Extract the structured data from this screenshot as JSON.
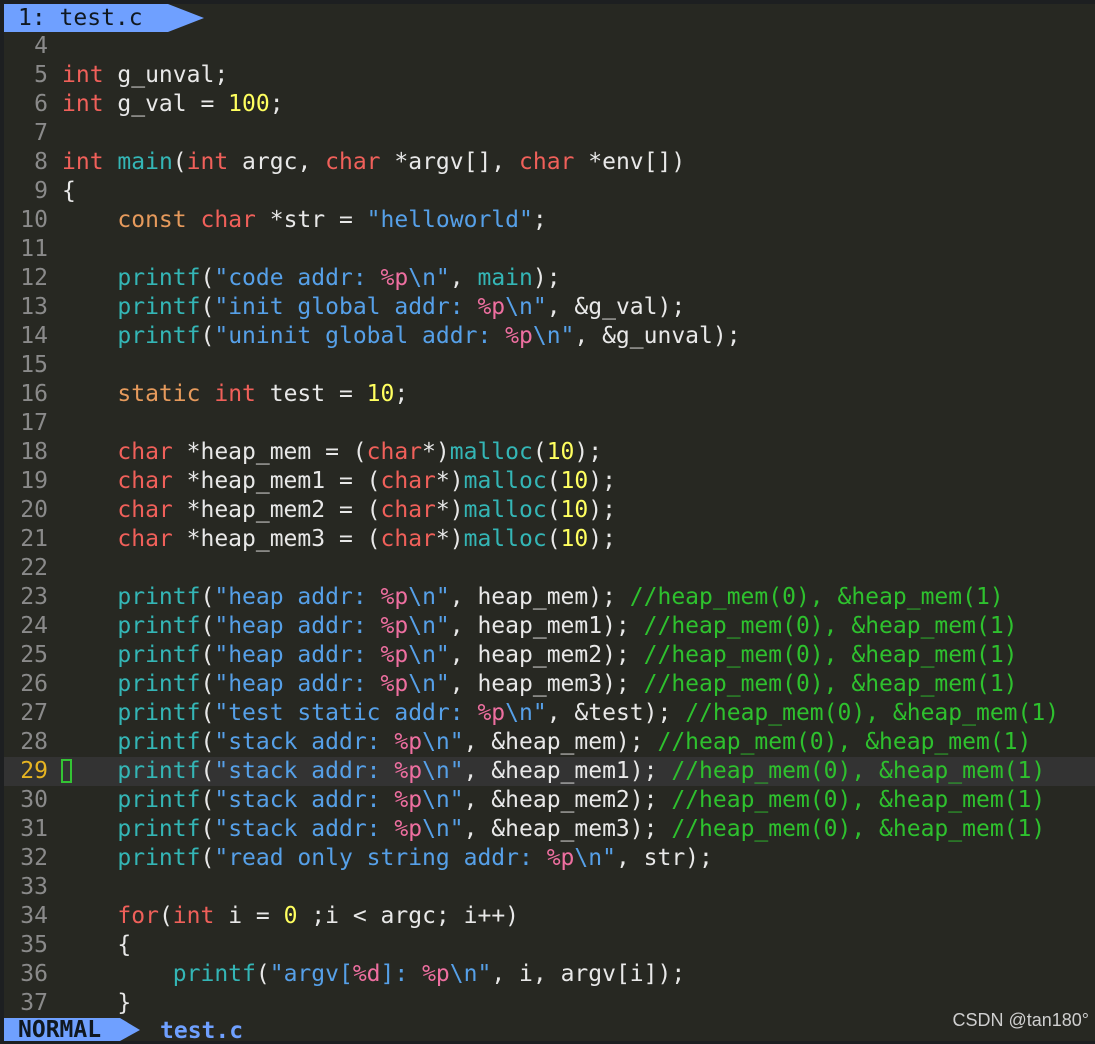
{
  "tabline": {
    "tab_label": "1: test.c"
  },
  "editor": {
    "current_line": 29,
    "lines": [
      {
        "n": "4",
        "seg": []
      },
      {
        "n": "5",
        "seg": [
          [
            "ty",
            "int"
          ],
          [
            "pl",
            " g_unval;"
          ]
        ]
      },
      {
        "n": "6",
        "seg": [
          [
            "ty",
            "int"
          ],
          [
            "pl",
            " g_val = "
          ],
          [
            "nm",
            "100"
          ],
          [
            "pl",
            ";"
          ]
        ]
      },
      {
        "n": "7",
        "seg": []
      },
      {
        "n": "8",
        "seg": [
          [
            "ty",
            "int"
          ],
          [
            "pl",
            " "
          ],
          [
            "fn",
            "main"
          ],
          [
            "pl",
            "("
          ],
          [
            "ty",
            "int"
          ],
          [
            "pl",
            " argc, "
          ],
          [
            "ty",
            "char"
          ],
          [
            "pl",
            " *argv[], "
          ],
          [
            "ty",
            "char"
          ],
          [
            "pl",
            " *env[])"
          ]
        ]
      },
      {
        "n": "9",
        "seg": [
          [
            "pl",
            "{"
          ]
        ]
      },
      {
        "n": "10",
        "seg": [
          [
            "pl",
            "    "
          ],
          [
            "cq",
            "const"
          ],
          [
            "pl",
            " "
          ],
          [
            "ty",
            "char"
          ],
          [
            "pl",
            " *str = "
          ],
          [
            "st",
            "\"helloworld\""
          ],
          [
            "pl",
            ";"
          ]
        ]
      },
      {
        "n": "11",
        "seg": []
      },
      {
        "n": "12",
        "seg": [
          [
            "pl",
            "    "
          ],
          [
            "fn",
            "printf"
          ],
          [
            "pl",
            "("
          ],
          [
            "st",
            "\"code addr: "
          ],
          [
            "fm",
            "%p"
          ],
          [
            "st",
            "\\n\""
          ],
          [
            "pl",
            ", "
          ],
          [
            "fn",
            "main"
          ],
          [
            "pl",
            ");"
          ]
        ]
      },
      {
        "n": "13",
        "seg": [
          [
            "pl",
            "    "
          ],
          [
            "fn",
            "printf"
          ],
          [
            "pl",
            "("
          ],
          [
            "st",
            "\"init global addr: "
          ],
          [
            "fm",
            "%p"
          ],
          [
            "st",
            "\\n\""
          ],
          [
            "pl",
            ", &g_val);"
          ]
        ]
      },
      {
        "n": "14",
        "seg": [
          [
            "pl",
            "    "
          ],
          [
            "fn",
            "printf"
          ],
          [
            "pl",
            "("
          ],
          [
            "st",
            "\"uninit global addr: "
          ],
          [
            "fm",
            "%p"
          ],
          [
            "st",
            "\\n\""
          ],
          [
            "pl",
            ", &g_unval);"
          ]
        ]
      },
      {
        "n": "15",
        "seg": []
      },
      {
        "n": "16",
        "seg": [
          [
            "pl",
            "    "
          ],
          [
            "cq",
            "static"
          ],
          [
            "pl",
            " "
          ],
          [
            "ty",
            "int"
          ],
          [
            "pl",
            " test = "
          ],
          [
            "nm",
            "10"
          ],
          [
            "pl",
            ";"
          ]
        ]
      },
      {
        "n": "17",
        "seg": []
      },
      {
        "n": "18",
        "seg": [
          [
            "pl",
            "    "
          ],
          [
            "ty",
            "char"
          ],
          [
            "pl",
            " *heap_mem = ("
          ],
          [
            "ty",
            "char"
          ],
          [
            "pl",
            "*)"
          ],
          [
            "fn",
            "malloc"
          ],
          [
            "pl",
            "("
          ],
          [
            "nm",
            "10"
          ],
          [
            "pl",
            ");"
          ]
        ]
      },
      {
        "n": "19",
        "seg": [
          [
            "pl",
            "    "
          ],
          [
            "ty",
            "char"
          ],
          [
            "pl",
            " *heap_mem1 = ("
          ],
          [
            "ty",
            "char"
          ],
          [
            "pl",
            "*)"
          ],
          [
            "fn",
            "malloc"
          ],
          [
            "pl",
            "("
          ],
          [
            "nm",
            "10"
          ],
          [
            "pl",
            ");"
          ]
        ]
      },
      {
        "n": "20",
        "seg": [
          [
            "pl",
            "    "
          ],
          [
            "ty",
            "char"
          ],
          [
            "pl",
            " *heap_mem2 = ("
          ],
          [
            "ty",
            "char"
          ],
          [
            "pl",
            "*)"
          ],
          [
            "fn",
            "malloc"
          ],
          [
            "pl",
            "("
          ],
          [
            "nm",
            "10"
          ],
          [
            "pl",
            ");"
          ]
        ]
      },
      {
        "n": "21",
        "seg": [
          [
            "pl",
            "    "
          ],
          [
            "ty",
            "char"
          ],
          [
            "pl",
            " *heap_mem3 = ("
          ],
          [
            "ty",
            "char"
          ],
          [
            "pl",
            "*)"
          ],
          [
            "fn",
            "malloc"
          ],
          [
            "pl",
            "("
          ],
          [
            "nm",
            "10"
          ],
          [
            "pl",
            ");"
          ]
        ]
      },
      {
        "n": "22",
        "seg": []
      },
      {
        "n": "23",
        "seg": [
          [
            "pl",
            "    "
          ],
          [
            "fn",
            "printf"
          ],
          [
            "pl",
            "("
          ],
          [
            "st",
            "\"heap addr: "
          ],
          [
            "fm",
            "%p"
          ],
          [
            "st",
            "\\n\""
          ],
          [
            "pl",
            ", heap_mem); "
          ],
          [
            "cm",
            "//heap_mem(0), &heap_mem(1)"
          ]
        ]
      },
      {
        "n": "24",
        "seg": [
          [
            "pl",
            "    "
          ],
          [
            "fn",
            "printf"
          ],
          [
            "pl",
            "("
          ],
          [
            "st",
            "\"heap addr: "
          ],
          [
            "fm",
            "%p"
          ],
          [
            "st",
            "\\n\""
          ],
          [
            "pl",
            ", heap_mem1); "
          ],
          [
            "cm",
            "//heap_mem(0), &heap_mem(1)"
          ]
        ]
      },
      {
        "n": "25",
        "seg": [
          [
            "pl",
            "    "
          ],
          [
            "fn",
            "printf"
          ],
          [
            "pl",
            "("
          ],
          [
            "st",
            "\"heap addr: "
          ],
          [
            "fm",
            "%p"
          ],
          [
            "st",
            "\\n\""
          ],
          [
            "pl",
            ", heap_mem2); "
          ],
          [
            "cm",
            "//heap_mem(0), &heap_mem(1)"
          ]
        ]
      },
      {
        "n": "26",
        "seg": [
          [
            "pl",
            "    "
          ],
          [
            "fn",
            "printf"
          ],
          [
            "pl",
            "("
          ],
          [
            "st",
            "\"heap addr: "
          ],
          [
            "fm",
            "%p"
          ],
          [
            "st",
            "\\n\""
          ],
          [
            "pl",
            ", heap_mem3); "
          ],
          [
            "cm",
            "//heap_mem(0), &heap_mem(1)"
          ]
        ]
      },
      {
        "n": "27",
        "seg": [
          [
            "pl",
            "    "
          ],
          [
            "fn",
            "printf"
          ],
          [
            "pl",
            "("
          ],
          [
            "st",
            "\"test static addr: "
          ],
          [
            "fm",
            "%p"
          ],
          [
            "st",
            "\\n\""
          ],
          [
            "pl",
            ", &test); "
          ],
          [
            "cm",
            "//heap_mem(0), &heap_mem(1)"
          ]
        ]
      },
      {
        "n": "28",
        "seg": [
          [
            "pl",
            "    "
          ],
          [
            "fn",
            "printf"
          ],
          [
            "pl",
            "("
          ],
          [
            "st",
            "\"stack addr: "
          ],
          [
            "fm",
            "%p"
          ],
          [
            "st",
            "\\n\""
          ],
          [
            "pl",
            ", &heap_mem); "
          ],
          [
            "cm",
            "//heap_mem(0), &heap_mem(1)"
          ]
        ]
      },
      {
        "n": "29",
        "seg": [
          [
            "pl",
            "    "
          ],
          [
            "fn",
            "printf"
          ],
          [
            "pl",
            "("
          ],
          [
            "st",
            "\"stack addr: "
          ],
          [
            "fm",
            "%p"
          ],
          [
            "st",
            "\\n\""
          ],
          [
            "pl",
            ", &heap_mem1); "
          ],
          [
            "cm",
            "//heap_mem(0), &heap_mem(1)"
          ]
        ]
      },
      {
        "n": "30",
        "seg": [
          [
            "pl",
            "    "
          ],
          [
            "fn",
            "printf"
          ],
          [
            "pl",
            "("
          ],
          [
            "st",
            "\"stack addr: "
          ],
          [
            "fm",
            "%p"
          ],
          [
            "st",
            "\\n\""
          ],
          [
            "pl",
            ", &heap_mem2); "
          ],
          [
            "cm",
            "//heap_mem(0), &heap_mem(1)"
          ]
        ]
      },
      {
        "n": "31",
        "seg": [
          [
            "pl",
            "    "
          ],
          [
            "fn",
            "printf"
          ],
          [
            "pl",
            "("
          ],
          [
            "st",
            "\"stack addr: "
          ],
          [
            "fm",
            "%p"
          ],
          [
            "st",
            "\\n\""
          ],
          [
            "pl",
            ", &heap_mem3); "
          ],
          [
            "cm",
            "//heap_mem(0), &heap_mem(1)"
          ]
        ]
      },
      {
        "n": "32",
        "seg": [
          [
            "pl",
            "    "
          ],
          [
            "fn",
            "printf"
          ],
          [
            "pl",
            "("
          ],
          [
            "st",
            "\"read only string addr: "
          ],
          [
            "fm",
            "%p"
          ],
          [
            "st",
            "\\n\""
          ],
          [
            "pl",
            ", str);"
          ]
        ]
      },
      {
        "n": "33",
        "seg": []
      },
      {
        "n": "34",
        "seg": [
          [
            "pl",
            "    "
          ],
          [
            "kw",
            "for"
          ],
          [
            "pl",
            "("
          ],
          [
            "ty",
            "int"
          ],
          [
            "pl",
            " i = "
          ],
          [
            "nm",
            "0"
          ],
          [
            "pl",
            " ;i < argc; i++)"
          ]
        ]
      },
      {
        "n": "35",
        "seg": [
          [
            "pl",
            "    {"
          ]
        ]
      },
      {
        "n": "36",
        "seg": [
          [
            "pl",
            "        "
          ],
          [
            "fn",
            "printf"
          ],
          [
            "pl",
            "("
          ],
          [
            "st",
            "\"argv["
          ],
          [
            "fm",
            "%d"
          ],
          [
            "st",
            "]: "
          ],
          [
            "fm",
            "%p"
          ],
          [
            "st",
            "\\n\""
          ],
          [
            "pl",
            ", i, argv[i]);"
          ]
        ]
      },
      {
        "n": "37",
        "seg": [
          [
            "pl",
            "    }"
          ]
        ]
      }
    ]
  },
  "statusline": {
    "mode": "NORMAL",
    "filename": "test.c"
  },
  "watermark": "CSDN @tan180°",
  "colors": {
    "accent": "#6fa0ff",
    "keyword": "#f0605a",
    "function": "#34b6b6",
    "string": "#56a0e8",
    "number": "#ffff5f",
    "comment": "#2ec12e",
    "format": "#ee6fa0"
  }
}
